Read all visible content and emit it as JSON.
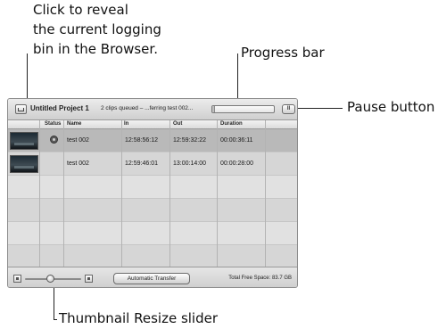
{
  "callouts": {
    "bin_line1": "Click to reveal",
    "bin_line2": "the current logging",
    "bin_line3": "bin in the Browser.",
    "progress": "Progress bar",
    "pause": "Pause button",
    "slider": "Thumbnail Resize slider"
  },
  "window": {
    "project_title": "Untitled Project 1",
    "status": "2 clips queued – ...ferring test 002...",
    "progress_fraction": 0.05,
    "pause_label": "II"
  },
  "columns": {
    "status": "Status",
    "name": "Name",
    "in": "In",
    "out": "Out",
    "duration": "Duration"
  },
  "rows": [
    {
      "name": "test 002",
      "in": "12:58:56:12",
      "out": "12:59:32:22",
      "duration": "00:00:36:11",
      "selected": true,
      "status_icon": "capturing-icon"
    },
    {
      "name": "test 002",
      "in": "12:59:46:01",
      "out": "13:00:14:00",
      "duration": "00:00:28:00",
      "selected": false
    }
  ],
  "footer": {
    "auto_transfer": "Automatic Transfer",
    "free_space": "Total Free Space: 83.7 GB",
    "thumbnail_size_fraction": 0.45
  }
}
